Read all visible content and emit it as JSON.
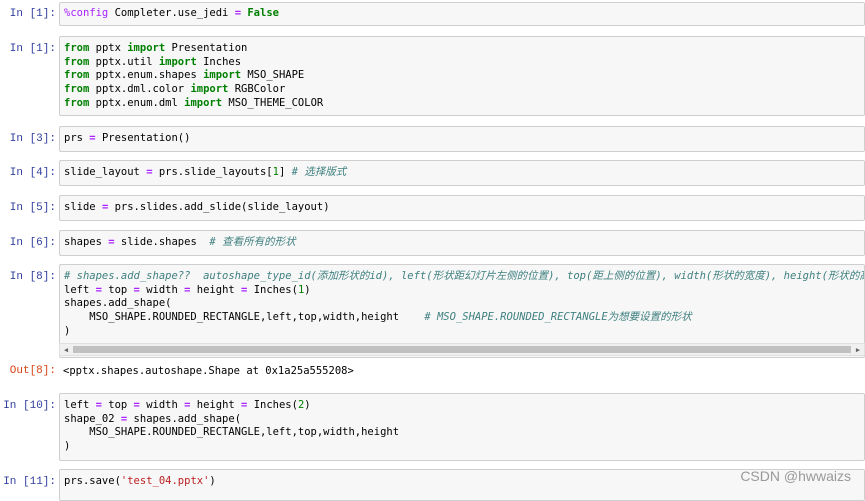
{
  "cells": [
    {
      "prompt": "In  [1]:",
      "code": "%config Completer.use_jedi = False"
    },
    {
      "prompt": "In  [1]:",
      "lines": [
        "from pptx import Presentation",
        "from pptx.util import Inches",
        "from pptx.enum.shapes import MSO_SHAPE",
        "from pptx.dml.color import RGBColor",
        "from pptx.enum.dml import MSO_THEME_COLOR"
      ]
    },
    {
      "prompt": "In  [3]:",
      "code": "prs = Presentation()"
    },
    {
      "prompt": "In  [4]:",
      "code": "slide_layout = prs.slide_layouts[1]",
      "comment": "# 选择版式"
    },
    {
      "prompt": "In  [5]:",
      "code": "slide = prs.slides.add_slide(slide_layout)"
    },
    {
      "prompt": "In  [6]:",
      "code": "shapes = slide.shapes ",
      "comment": "# 查看所有的形状"
    },
    {
      "prompt": "In  [8]:",
      "lines": [
        "# shapes.add_shape??  autoshape_type_id(添加形状的id), left(形状距幻灯片左侧的位置), top(距上侧的位置), width(形状的宽度), height(形状的高度",
        "left = top = width = height = Inches(1)",
        "shapes.add_shape(",
        "    MSO_SHAPE.ROUNDED_RECTANGLE,left,top,width,height    # MSO_SHAPE.ROUNDED_RECTANGLE为想要设置的形状",
        ")"
      ]
    },
    {
      "prompt": "Out[8]:",
      "output": "<pptx.shapes.autoshape.Shape at 0x1a25a555208>"
    },
    {
      "prompt": "In  [10]:",
      "lines": [
        "left = top = width = height = Inches(2)",
        "shape_02 = shapes.add_shape(",
        "    MSO_SHAPE.ROUNDED_RECTANGLE,left,top,width,height",
        ")"
      ]
    },
    {
      "prompt": "In  [11]:",
      "code": "prs.save('test_04.pptx')"
    }
  ],
  "watermark": "CSDN @hwwaizs",
  "scroll_left_icon": "◀",
  "scroll_right_icon": "▶"
}
